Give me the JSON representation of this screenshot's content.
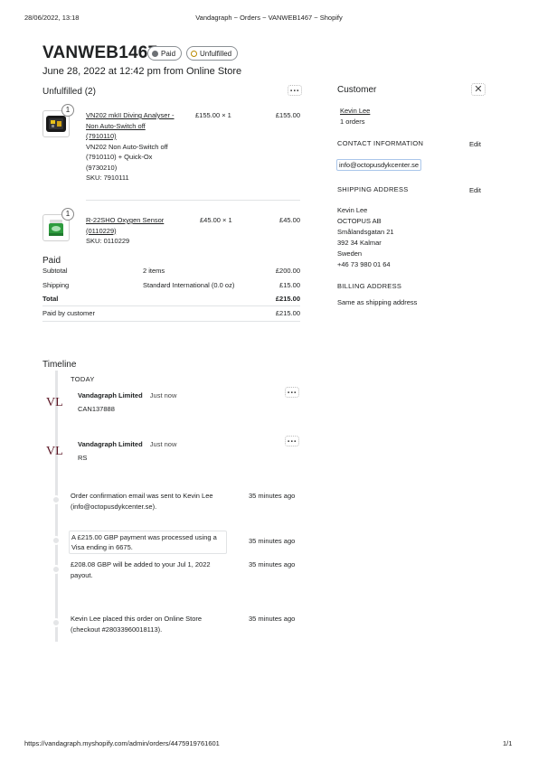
{
  "print_header": {
    "datetime": "28/06/2022, 13:18",
    "page_title": "Vandagraph ~ Orders ~ VANWEB1467 ~ Shopify"
  },
  "order": {
    "id": "VANWEB1467",
    "badge_paid": "Paid",
    "badge_unfulfilled": "Unfulfilled",
    "subtitle": "June 28, 2022 at 12:42 pm from Online Store"
  },
  "unfulfilled": {
    "title": "Unfulfilled (2)",
    "items": [
      {
        "qty_badge": "1",
        "name_line1": "VN202 mkII Diving Analyser -",
        "name_line2": "Non Auto-Switch off",
        "name_line3": "(7910110)",
        "variant_line1": "VN202 Non Auto-Switch off",
        "variant_line2": "(7910110) + Quick-Ox",
        "variant_line3": "(9730210)",
        "sku": "SKU: 7910111",
        "unit": "£155.00 × 1",
        "total": "£155.00"
      },
      {
        "qty_badge": "1",
        "name_line1": "R-22SHO Oxygen Sensor",
        "name_line2": "(0110229)",
        "sku": "SKU: 0110229",
        "unit": "£45.00 × 1",
        "total": "£45.00"
      }
    ]
  },
  "paid": {
    "title": "Paid",
    "rows": [
      {
        "label": "Subtotal",
        "detail": "2 items",
        "amount": "£200.00"
      },
      {
        "label": "Shipping",
        "detail": "Standard International (0.0 oz)",
        "amount": "£15.00"
      },
      {
        "label": "Total",
        "detail": "",
        "amount": "£215.00"
      },
      {
        "label": "Paid by customer",
        "detail": "",
        "amount": "£215.00"
      }
    ]
  },
  "customer": {
    "title": "Customer",
    "name": "Kevin Lee",
    "orders": "1 orders",
    "contact_title": "CONTACT INFORMATION",
    "contact_edit": "Edit",
    "email": "info@octopusdykcenter.se",
    "shipping_title": "SHIPPING ADDRESS",
    "shipping_edit": "Edit",
    "address": [
      "Kevin Lee",
      "OCTOPUS AB",
      "Smålandsgatan 21",
      "392 34 Kalmar",
      "Sweden",
      "+46 73 980 01 64"
    ],
    "billing_title": "BILLING ADDRESS",
    "billing_text": "Same as shipping address"
  },
  "timeline": {
    "title": "Timeline",
    "today": "TODAY",
    "comments": [
      {
        "avatar": "VL",
        "author": "Vandagraph Limited",
        "time": "Just now",
        "text": "CAN137888"
      },
      {
        "avatar": "VL",
        "author": "Vandagraph Limited",
        "time": "Just now",
        "text": "RS"
      }
    ],
    "events": [
      {
        "line1": "Order confirmation email was sent to Kevin Lee",
        "line2": "(info@octopusdykcenter.se).",
        "time": "35 minutes ago"
      },
      {
        "line1": "A £215.00 GBP payment was processed using a",
        "line2": "Visa ending in 6675.",
        "time": "35 minutes ago"
      },
      {
        "line1": "£208.08 GBP will be added to your Jul 1, 2022",
        "line2": "payout.",
        "time": "35 minutes ago"
      },
      {
        "line1": "Kevin Lee placed this order on Online Store",
        "line2": "(checkout #28033960018113).",
        "time": "35 minutes ago"
      }
    ]
  },
  "footer": {
    "url": "https://vandagraph.myshopify.com/admin/orders/4475919761601",
    "page": "1/1"
  },
  "icons": {
    "more": "more-horizontal-icon",
    "close": "close-icon",
    "status_dot": "status-dot-icon"
  },
  "colors": {
    "paid_dot": "#6d7175",
    "unfulfilled_ring": "#b98900",
    "avatar_text": "#5c1725",
    "product2_green": "#2e9b3e"
  }
}
